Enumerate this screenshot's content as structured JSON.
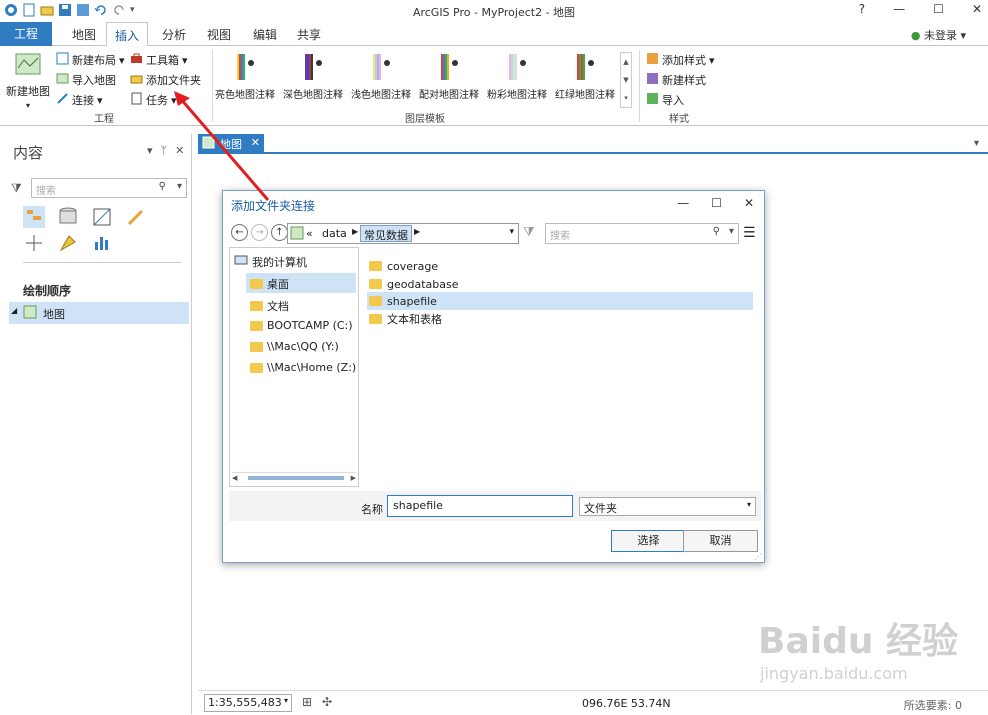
{
  "window": {
    "title": "ArcGIS Pro - MyProject2 - 地图",
    "help": "?",
    "minimize": "—",
    "maximize": "☐",
    "close": "✕"
  },
  "ribbon": {
    "tabs": [
      "工程",
      "地图",
      "插入",
      "分析",
      "视图",
      "编辑",
      "共享"
    ],
    "active_tab": "插入",
    "user": "未登录",
    "project_group": {
      "new_map": "新建地图",
      "new_layout": "新建布局",
      "import_map": "导入地图",
      "connect": "连接",
      "toolbox": "工具箱",
      "add_folder": "添加文件夹",
      "tasks": "任务",
      "label": "工程"
    },
    "layer_templates": {
      "items": [
        "亮色地图注释",
        "深色地图注释",
        "浅色地图注释",
        "配对地图注释",
        "粉彩地图注释",
        "红绿地图注释"
      ],
      "label": "图层模板"
    },
    "styles_group": {
      "add_style": "添加样式",
      "new_style": "新建样式",
      "import": "导入",
      "label": "样式"
    }
  },
  "contents": {
    "title": "内容",
    "search_placeholder": "搜索",
    "drawing_order": "绘制顺序",
    "map_layer": "地图"
  },
  "map_view": {
    "tab_label": "地图",
    "scale": "1:35,555,483",
    "coordinates": "096.76E 53.74N",
    "selected_features": "所选要素: 0"
  },
  "dialog": {
    "title": "添加文件夹连接",
    "breadcrumb": [
      "«",
      "data",
      "常见数据"
    ],
    "search_placeholder": "搜索",
    "tree": {
      "root": "我的计算机",
      "items": [
        "桌面",
        "文档",
        "BOOTCAMP (C:)",
        "\\\\Mac\\QQ (Y:)",
        "\\\\Mac\\Home (Z:)"
      ],
      "selected": "桌面"
    },
    "files": [
      "coverage",
      "geodatabase",
      "shapefile",
      "文本和表格"
    ],
    "selected_file": "shapefile",
    "name_label": "名称",
    "name_value": "shapefile",
    "filter_value": "文件夹",
    "ok_button": "选择",
    "cancel_button": "取消"
  },
  "watermark": {
    "brand": "Baidu 经验",
    "url": "jingyan.baidu.com"
  },
  "colors": {
    "accent": "#2f7cc2",
    "selection": "#cfe3f7",
    "annotation_arrow": "#e02020"
  }
}
